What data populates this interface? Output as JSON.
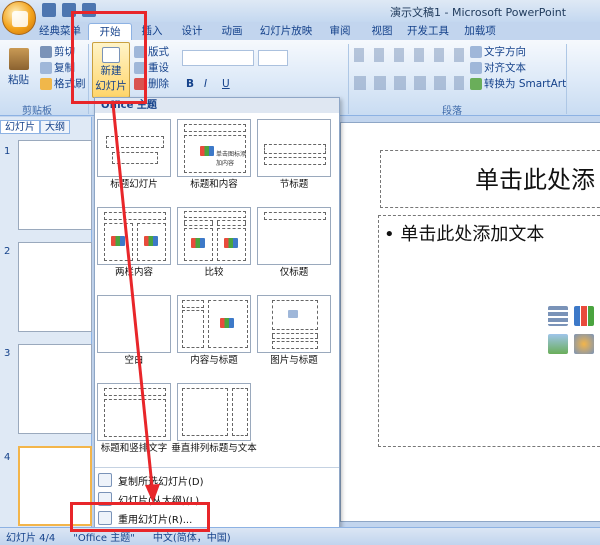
{
  "window": {
    "title": "演示文稿1 - Microsoft PowerPoint"
  },
  "tabs": [
    {
      "label": "经典菜单"
    },
    {
      "label": "开始"
    },
    {
      "label": "插入"
    },
    {
      "label": "设计"
    },
    {
      "label": "动画"
    },
    {
      "label": "幻灯片放映"
    },
    {
      "label": "审阅"
    },
    {
      "label": "视图"
    },
    {
      "label": "开发工具"
    },
    {
      "label": "加载项"
    }
  ],
  "ribbon": {
    "clipboard": {
      "paste": "粘贴",
      "cut": "剪切",
      "copy": "复制",
      "format_painter": "格式刷",
      "label": "剪贴板"
    },
    "slides": {
      "new_slide_line1": "新建",
      "new_slide_line2": "幻灯片",
      "layout": "版式",
      "reset": "重设",
      "delete": "删除"
    },
    "font_bold": "B",
    "font_italic": "I",
    "font_underline": "U",
    "paragraph": {
      "text_direction": "文字方向",
      "align_text": "对齐文本",
      "smartart": "转换为 SmartArt",
      "label": "段落"
    }
  },
  "pane": {
    "tab_slides": "幻灯片",
    "tab_outline": "大纲",
    "slide_numbers": [
      "1",
      "2",
      "3",
      "4"
    ]
  },
  "gallery": {
    "header": "Office 主题",
    "layouts": [
      {
        "label": "标题幻灯片"
      },
      {
        "label": "标题和内容"
      },
      {
        "label": "节标题"
      },
      {
        "label": "两栏内容"
      },
      {
        "label": "比较"
      },
      {
        "label": "仅标题"
      },
      {
        "label": "空白"
      },
      {
        "label": "内容与标题"
      },
      {
        "label": "图片与标题"
      },
      {
        "label": "标题和竖排文字"
      },
      {
        "label": "垂直排列标题与文本"
      }
    ],
    "menu": [
      {
        "label": "复制所选幻灯片(D)"
      },
      {
        "label": "幻灯片(从大纲)(L)..."
      },
      {
        "label": "重用幻灯片(R)..."
      }
    ],
    "mini_icon_text": "单击图标添加内容"
  },
  "slide": {
    "title_placeholder": "单击此处添",
    "body_placeholder": "• 单击此处添加文本"
  },
  "statusbar": {
    "slide_pos": "幻灯片 4/4",
    "theme": "\"Office 主题\"",
    "language": "中文(简体，中国)"
  },
  "colors": {
    "annotation": "#e8262a",
    "accent": "#15428b"
  }
}
